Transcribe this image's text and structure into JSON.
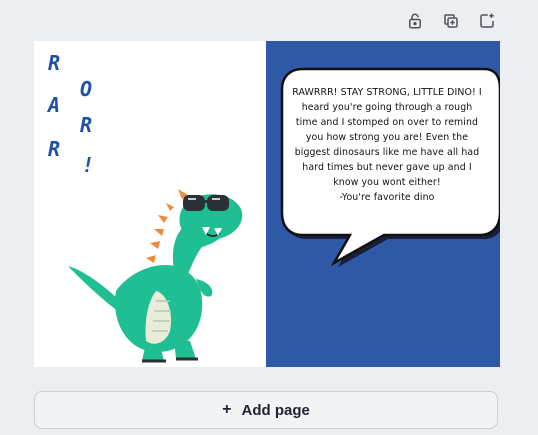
{
  "toolbar": {
    "lock_icon": "lock-icon",
    "duplicate_icon": "duplicate-page-icon",
    "add_icon": "add-page-icon"
  },
  "card": {
    "roar_letters": [
      "R",
      "O",
      "A",
      "R",
      "R",
      "!"
    ],
    "bubble": {
      "message": "RAWRRR! STAY STRONG, LITTLE DINO! I heard you're going through a rough time and I stomped on over to remind you how strong you are! Even the biggest dinosaurs like me have all had hard times but never gave up and I know you wont either!",
      "signature": "-You're favorite dino"
    },
    "colors": {
      "right_panel": "#2f58a7",
      "dino": "#1fbf93",
      "roar_text": "#1f4fa8"
    }
  },
  "add_page": {
    "icon": "+",
    "label": "Add page"
  }
}
